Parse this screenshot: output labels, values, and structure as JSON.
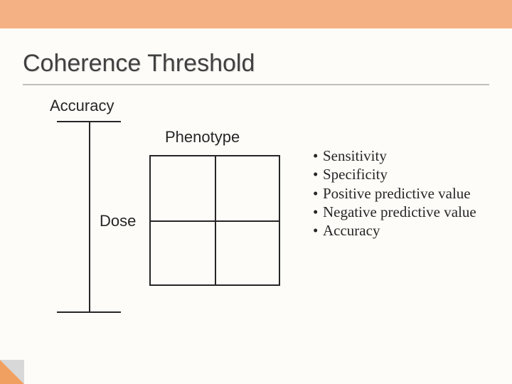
{
  "title": "Coherence Threshold",
  "labels": {
    "accuracy": "Accuracy",
    "phenotype": "Phenotype",
    "dose": "Dose"
  },
  "bullets": [
    "Sensitivity",
    "Specificity",
    "Positive predictive value",
    "Negative predictive value",
    "Accuracy"
  ]
}
